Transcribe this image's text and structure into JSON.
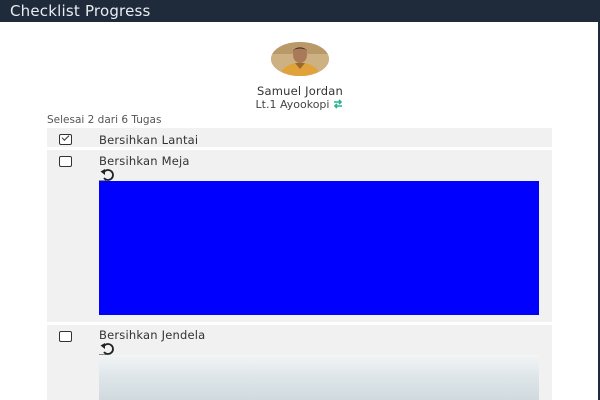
{
  "header": {
    "title": "Checklist Progress"
  },
  "profile": {
    "name": "Samuel Jordan",
    "location": "Lt.1 Ayookopi",
    "location_icon": "transfer-icon",
    "colors": {
      "location_icon": "#27b48f"
    }
  },
  "summary": "Selesai 2 dari 6 Tugas",
  "tasks": [
    {
      "label": "Bersihkan Lantai",
      "checked": true
    },
    {
      "label": "Bersihkan Meja",
      "checked": false,
      "icon": "undo-icon",
      "image_color": "#0000ff"
    },
    {
      "label": "Bersihkan Jendela",
      "checked": false,
      "icon": "undo-icon"
    }
  ],
  "colors": {
    "header_bg": "#1f2a3a",
    "row_bg": "#f1f1f1"
  }
}
